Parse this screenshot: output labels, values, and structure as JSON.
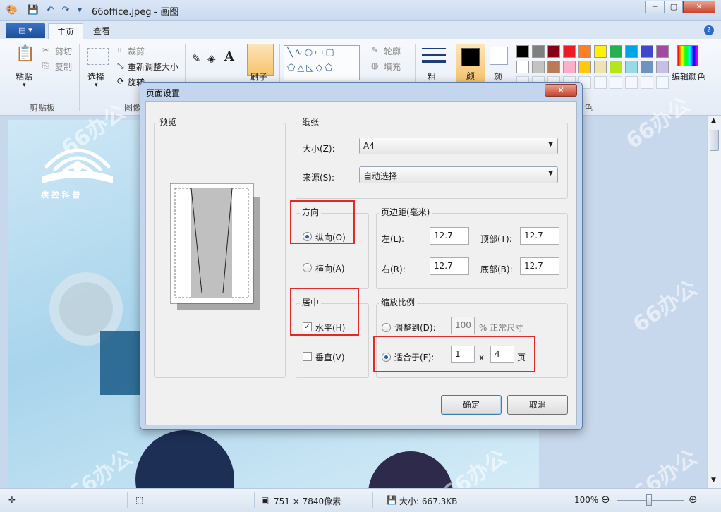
{
  "window": {
    "title": "66office.jpeg - 画图",
    "controls": [
      "─",
      "▢",
      "✕"
    ]
  },
  "ribbon": {
    "tabs": [
      "主页",
      "查看"
    ],
    "file_menu": "▤ ▾",
    "clipboard": {
      "paste": "粘贴",
      "cut": "剪切",
      "copy": "复制",
      "group": "剪贴板"
    },
    "image": {
      "select": "选择",
      "crop": "裁剪",
      "resize": "重新调整大小",
      "rotate": "旋转",
      "group": "图像"
    },
    "brush": {
      "label": "刷子"
    },
    "shapes": {
      "outline": "轮廓",
      "fill": "填充"
    },
    "size": {
      "label": "粗"
    },
    "colors": {
      "color1": "颜",
      "color2": "颜",
      "edit": "编辑颜色",
      "group_tail": "色",
      "palette": [
        "#000000",
        "#7f7f7f",
        "#880015",
        "#ed1c24",
        "#ff7f27",
        "#fff200",
        "#22b14c",
        "#00a2e8",
        "#3f48cc",
        "#a349a4",
        "#ffffff",
        "#c3c3c3",
        "#b97a57",
        "#ffaec9",
        "#ffc90e",
        "#efe4b0",
        "#b5e61d",
        "#99d9ea",
        "#7092be",
        "#c8bfe7"
      ]
    }
  },
  "dialog": {
    "title": "页面设置",
    "close": "✕",
    "preview_title": "预览",
    "paper": {
      "title": "纸张",
      "size_label": "大小(Z):",
      "size_value": "A4",
      "source_label": "来源(S):",
      "source_value": "自动选择"
    },
    "orientation": {
      "title": "方向",
      "portrait": "纵向(O)",
      "landscape": "横向(A)",
      "selected": "portrait"
    },
    "margins": {
      "title": "页边距(毫米)",
      "left_label": "左(L):",
      "left": "12.7",
      "right_label": "右(R):",
      "right": "12.7",
      "top_label": "顶部(T):",
      "top": "12.7",
      "bottom_label": "底部(B):",
      "bottom": "12.7"
    },
    "center": {
      "title": "居中",
      "horizontal": "水平(H)",
      "vertical": "垂直(V)",
      "horizontal_checked": true,
      "vertical_checked": false
    },
    "scale": {
      "title": "缩放比例",
      "adjust_label": "调整到(D):",
      "adjust_value": "100",
      "adjust_unit": "% 正常尺寸",
      "fit_label": "适合于(F):",
      "fit_width": "1",
      "fit_x": "x",
      "fit_height": "4",
      "fit_unit": "页"
    },
    "ok": "确定",
    "cancel": "取消"
  },
  "status": {
    "dimensions": "751 × 7840像素",
    "size": "大小: 667.3KB",
    "zoom": "100%"
  },
  "canvas_text": {
    "logo": "疾 控 科 普"
  },
  "watermark": "66办公"
}
